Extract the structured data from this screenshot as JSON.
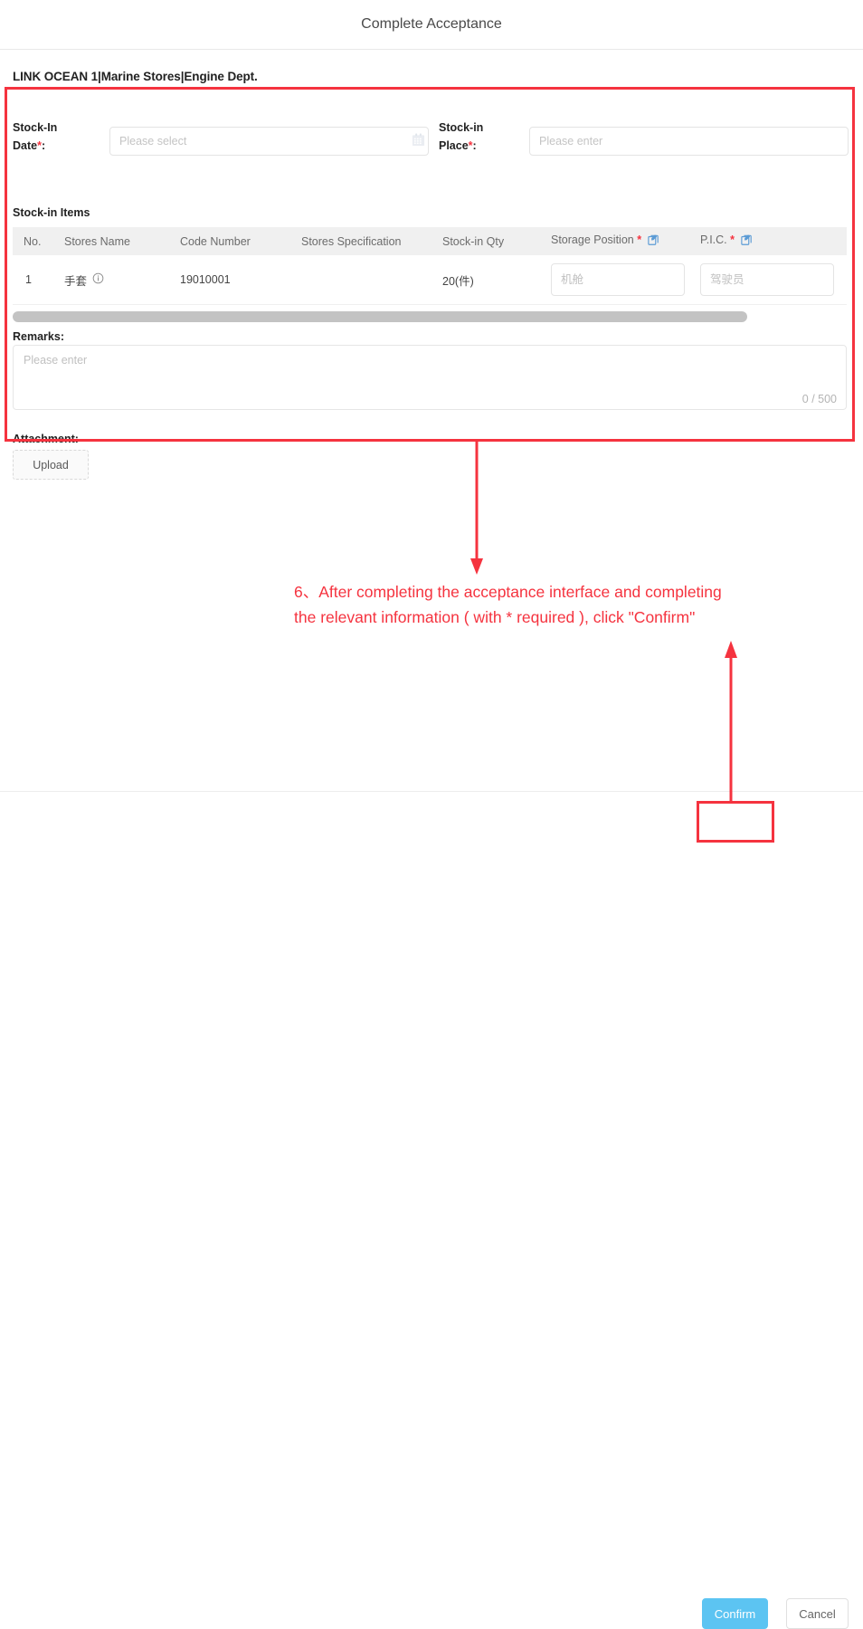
{
  "modal": {
    "title": "Complete Acceptance"
  },
  "vessel": {
    "breadcrumb": "LINK OCEAN 1|Marine Stores|Engine Dept."
  },
  "form": {
    "stock_in_date": {
      "label_line1": "Stock-In",
      "label_line2": "Date",
      "required_mark": "*",
      "colon": ":",
      "placeholder": "Please select",
      "value": "",
      "icon": "calendar-icon"
    },
    "stock_in_place": {
      "label_line1": "Stock-in",
      "label_line2": "Place",
      "required_mark": "*",
      "colon": ":",
      "placeholder": "Please enter",
      "value": ""
    },
    "items_section_title": "Stock-in Items",
    "remarks": {
      "label": "Remarks:",
      "placeholder": "Please enter",
      "value": "",
      "counter": "0 / 500"
    },
    "attachment": {
      "label": "Attachment:",
      "upload_label": "Upload",
      "upload_icon": "upload-icon"
    }
  },
  "table": {
    "columns": [
      {
        "key": "no",
        "label": "No."
      },
      {
        "key": "name",
        "label": "Stores Name"
      },
      {
        "key": "code",
        "label": "Code Number"
      },
      {
        "key": "spec",
        "label": "Stores Specification"
      },
      {
        "key": "qty",
        "label": "Stock-in Qty"
      },
      {
        "key": "pos",
        "label": "Storage Position",
        "required_mark": "*",
        "icon": "edit-batch-icon"
      },
      {
        "key": "pic",
        "label": "P.I.C.",
        "required_mark": "*",
        "icon": "edit-batch-icon"
      }
    ],
    "rows": [
      {
        "no": "1",
        "name": "手套",
        "name_icon": "info-circle-icon",
        "code": "19010001",
        "spec": "",
        "qty": "20(件)",
        "pos_placeholder": "机舱",
        "pos_value": "",
        "pic_placeholder": "驾驶员",
        "pic_value": ""
      }
    ],
    "scrollbar": {
      "orientation": "horizontal",
      "thumb_ratio": 0.88
    }
  },
  "annotation": {
    "text_line1": "6、After completing the acceptance interface and completing",
    "text_line2": "the relevant information ( with * required ), click \"Confirm\"",
    "color": "#f5333f"
  },
  "footer": {
    "confirm_label": "Confirm",
    "cancel_label": "Cancel"
  },
  "colors": {
    "accent_blue": "#5cc4f2",
    "annotation_red": "#f5333f",
    "required_star": "#f5333f",
    "table_header_bg": "#f0f0f0",
    "edit_icon_blue": "#5b9bd5"
  }
}
